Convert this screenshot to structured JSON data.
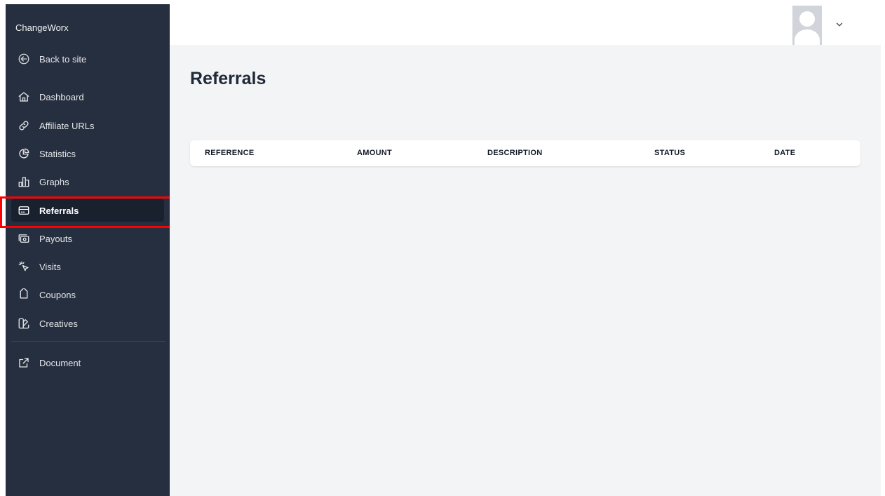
{
  "brand": "ChangeWorx",
  "sidebar": {
    "back_label": "Back to site",
    "items": [
      {
        "label": "Dashboard",
        "icon": "home-icon"
      },
      {
        "label": "Affiliate URLs",
        "icon": "link-icon"
      },
      {
        "label": "Statistics",
        "icon": "pie-chart-icon"
      },
      {
        "label": "Graphs",
        "icon": "bar-graph-icon"
      },
      {
        "label": "Referrals",
        "icon": "credit-card-icon",
        "active": true
      },
      {
        "label": "Payouts",
        "icon": "cash-icon"
      },
      {
        "label": "Visits",
        "icon": "cursor-click-icon"
      },
      {
        "label": "Coupons",
        "icon": "tag-icon"
      },
      {
        "label": "Creatives",
        "icon": "color-swatch-icon"
      }
    ],
    "document_label": "Document"
  },
  "main": {
    "title": "Referrals",
    "table": {
      "headers": [
        "REFERENCE",
        "AMOUNT",
        "DESCRIPTION",
        "STATUS",
        "DATE"
      ]
    }
  },
  "colors": {
    "sidebar_bg": "#262f3f",
    "active_bg": "#1a212e",
    "main_bg": "#f3f4f6",
    "highlight": "#ff0000"
  }
}
